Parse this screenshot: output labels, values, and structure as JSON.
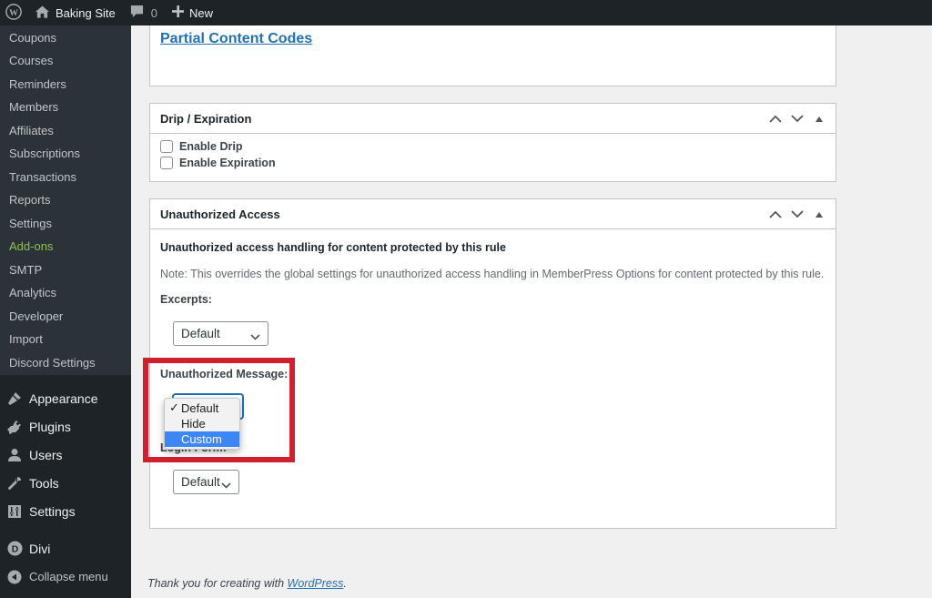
{
  "admin_bar": {
    "site_name": "Baking Site",
    "comments_count": "0",
    "new_label": "New"
  },
  "sidebar": {
    "submenu": [
      {
        "label": "Coupons"
      },
      {
        "label": "Courses"
      },
      {
        "label": "Reminders"
      },
      {
        "label": "Members"
      },
      {
        "label": "Affiliates"
      },
      {
        "label": "Subscriptions"
      },
      {
        "label": "Transactions"
      },
      {
        "label": "Reports"
      },
      {
        "label": "Settings"
      },
      {
        "label": "Add-ons"
      },
      {
        "label": "SMTP"
      },
      {
        "label": "Analytics"
      },
      {
        "label": "Developer"
      },
      {
        "label": "Import"
      },
      {
        "label": "Discord Settings"
      }
    ],
    "menu": [
      {
        "label": "Appearance",
        "icon": "paintbrush-icon"
      },
      {
        "label": "Plugins",
        "icon": "plugin-icon"
      },
      {
        "label": "Users",
        "icon": "user-icon"
      },
      {
        "label": "Tools",
        "icon": "wrench-icon"
      },
      {
        "label": "Settings",
        "icon": "sliders-icon"
      },
      {
        "label": "Divi",
        "icon": "divi-icon"
      }
    ],
    "collapse_label": "Collapse menu"
  },
  "partial_content": {
    "link_label": "Partial Content Codes"
  },
  "drip_box": {
    "title": "Drip / Expiration",
    "checkboxes": [
      {
        "label": "Enable Drip",
        "checked": false
      },
      {
        "label": "Enable Expiration",
        "checked": false
      }
    ]
  },
  "ua_box": {
    "title": "Unauthorized Access",
    "subtitle": "Unauthorized access handling for content protected by this rule",
    "note": "Note: This overrides the global settings for unauthorized access handling in MemberPress Options for content protected by this rule.",
    "excerpts_label": "Excerpts:",
    "excerpts_value": "Default",
    "message_label": "Unauthorized Message:",
    "message_options": [
      {
        "label": "Default",
        "selected": true,
        "highlighted": false
      },
      {
        "label": "Hide",
        "selected": false,
        "highlighted": false
      },
      {
        "label": "Custom",
        "selected": false,
        "highlighted": true
      }
    ],
    "login_label": "Login Form:",
    "login_value": "Default"
  },
  "colors": {
    "annotation_highlight": "#d0202e",
    "link": "#2271b1",
    "addons_green": "#8cc153",
    "option_highlight": "#3b87f7"
  },
  "footer": {
    "text": "Thank you for creating with ",
    "link": "WordPress",
    "suffix": "."
  }
}
